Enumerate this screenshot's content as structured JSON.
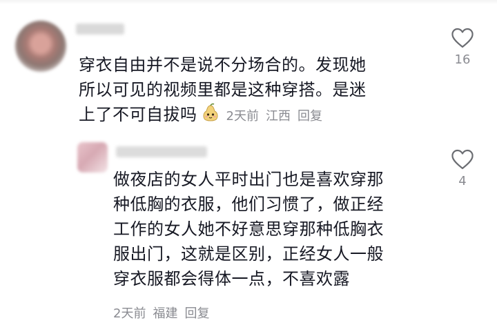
{
  "comments": [
    {
      "text_lines": [
        "穿衣自由并不是说不分场合的。发现她",
        "所以可见的视频里都是这种穿搭。是迷",
        "上了不可自拔吗"
      ],
      "emoji": "pear-face-emoji",
      "time": "2天前",
      "location": "江西",
      "reply_label": "回复",
      "likes": "16"
    },
    {
      "text_lines": [
        "做夜店的女人平时出门也是喜欢穿那",
        "种低胸的衣服，他们习惯了，做正经",
        "工作的女人她不好意思穿那种低胸衣",
        "服出门，这就是区别，正经女人一般",
        "穿衣服都会得体一点，不喜欢露"
      ],
      "time": "2天前",
      "location": "福建",
      "reply_label": "回复",
      "likes": "4"
    }
  ],
  "icons": {
    "like": "heart-outline-icon"
  },
  "colors": {
    "text": "#161823",
    "meta": "#8a8b91",
    "icon": "#6b6d72"
  }
}
